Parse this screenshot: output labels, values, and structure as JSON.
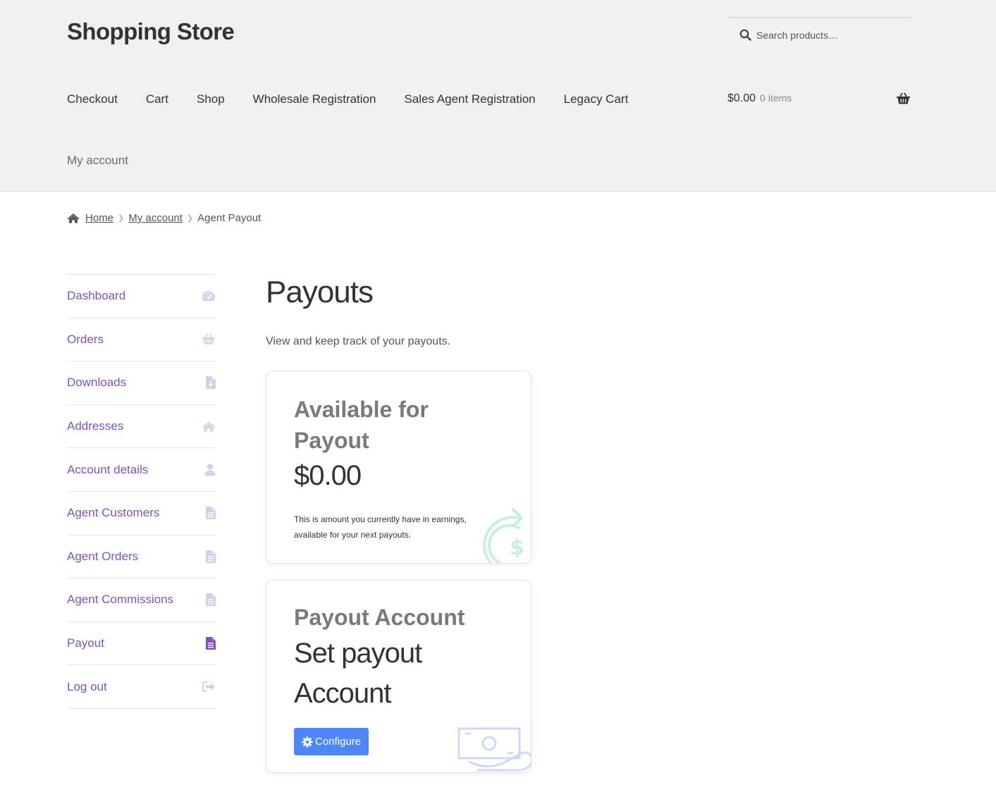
{
  "site": {
    "title": "Shopping Store"
  },
  "search": {
    "placeholder": "Search products…"
  },
  "nav": {
    "items": [
      "Checkout",
      "Cart",
      "Shop",
      "Wholesale Registration",
      "Sales Agent Registration",
      "Legacy Cart"
    ],
    "second_row": "My account"
  },
  "cart": {
    "amount": "$0.00",
    "count": "0 items"
  },
  "breadcrumb": {
    "home": "Home",
    "account": "My account",
    "current": "Agent Payout"
  },
  "sidebar": {
    "items": [
      {
        "label": "Dashboard",
        "icon": "dashboard-icon"
      },
      {
        "label": "Orders",
        "icon": "basket-icon"
      },
      {
        "label": "Downloads",
        "icon": "file-download-icon"
      },
      {
        "label": "Addresses",
        "icon": "home-icon"
      },
      {
        "label": "Account details",
        "icon": "user-icon"
      },
      {
        "label": "Agent Customers",
        "icon": "document-icon"
      },
      {
        "label": "Agent Orders",
        "icon": "document-icon"
      },
      {
        "label": "Agent Commissions",
        "icon": "document-icon"
      },
      {
        "label": "Payout",
        "icon": "document-icon",
        "active": true
      },
      {
        "label": "Log out",
        "icon": "sign-out-icon"
      }
    ]
  },
  "main": {
    "title": "Payouts",
    "intro": "View and keep track of your payouts.",
    "available": {
      "title": "Available for Payout",
      "value": "$0.00",
      "description": "This is amount you currently have in earnings, available for your next payouts."
    },
    "account": {
      "title": "Payout Account",
      "value": "Set payout Account",
      "button": "Configure"
    }
  },
  "colors": {
    "accent": "#7f54b3",
    "button": "#4f86f7",
    "header_bg": "#f0f0f0"
  }
}
